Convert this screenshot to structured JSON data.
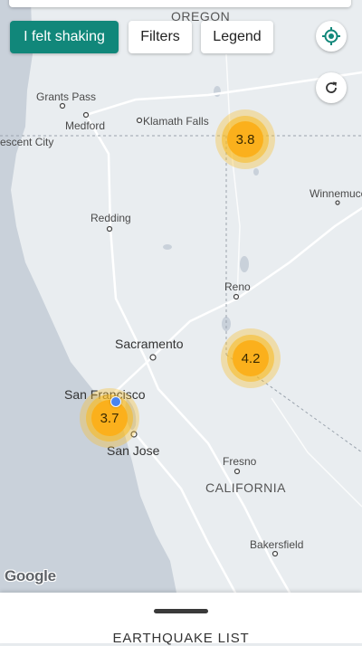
{
  "toolbar": {
    "felt_shaking_label": "I felt shaking",
    "filters_label": "Filters",
    "legend_label": "Legend"
  },
  "map": {
    "labels": {
      "oregon": "OREGON",
      "grants_pass": "Grants Pass",
      "medford": "Medford",
      "klamath_falls": "Klamath Falls",
      "crescent_city": "escent City",
      "winnemucca": "Winnemucca",
      "redding": "Redding",
      "reno": "Reno",
      "sacramento": "Sacramento",
      "san_francisco": "San Francisco",
      "san_jose": "San Jose",
      "fresno": "Fresno",
      "california": "CALIFORNIA",
      "bakersfield": "Bakersfield"
    },
    "clusters": [
      {
        "magnitude": "3.8"
      },
      {
        "magnitude": "4.2"
      },
      {
        "magnitude": "3.7"
      }
    ],
    "attribution": "Google"
  },
  "sheet": {
    "title": "EARTHQUAKE LIST"
  },
  "colors": {
    "primary": "#11877a",
    "cluster": "#fbb01c",
    "water": "#c9d1da",
    "land": "#e9edf0",
    "location": "#4a84f0"
  },
  "icons": {
    "locate": "my-location-icon",
    "refresh": "refresh-icon"
  }
}
